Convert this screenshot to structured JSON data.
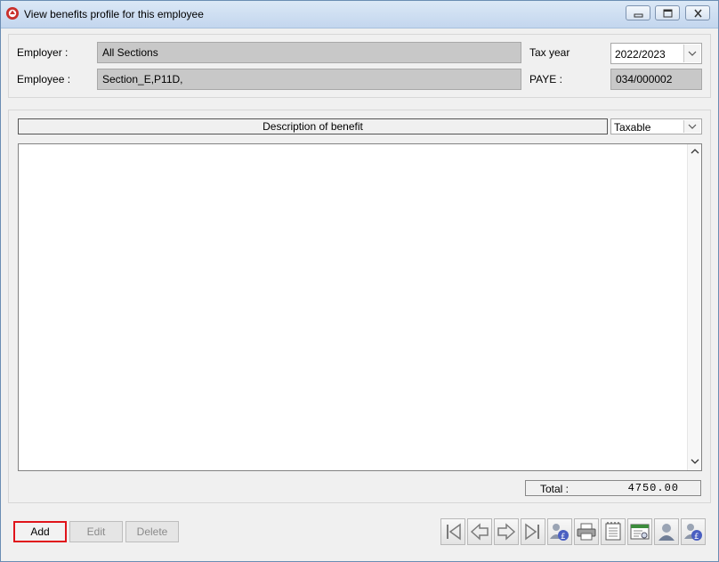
{
  "window": {
    "title": "View benefits profile for this employee"
  },
  "header": {
    "employer_label": "Employer :",
    "employer_value": "All Sections",
    "employee_label": "Employee :",
    "employee_value": "Section_E,P11D,",
    "tax_year_label": "Tax year",
    "tax_year_value": "2022/2023",
    "paye_label": "PAYE :",
    "paye_value": "034/000002"
  },
  "list": {
    "column_header": "Description of benefit",
    "filter_value": "Taxable",
    "rows": []
  },
  "totals": {
    "label": "Total :",
    "value": "4750.00"
  },
  "actions": {
    "add": "Add",
    "edit": "Edit",
    "delete": "Delete"
  },
  "toolbar_icons": [
    "first-record-icon",
    "previous-record-icon",
    "next-record-icon",
    "last-record-icon",
    "employee-pay-icon",
    "print-icon",
    "notepad-icon",
    "report-icon",
    "employee-icon",
    "employee-pay-alt-icon"
  ]
}
